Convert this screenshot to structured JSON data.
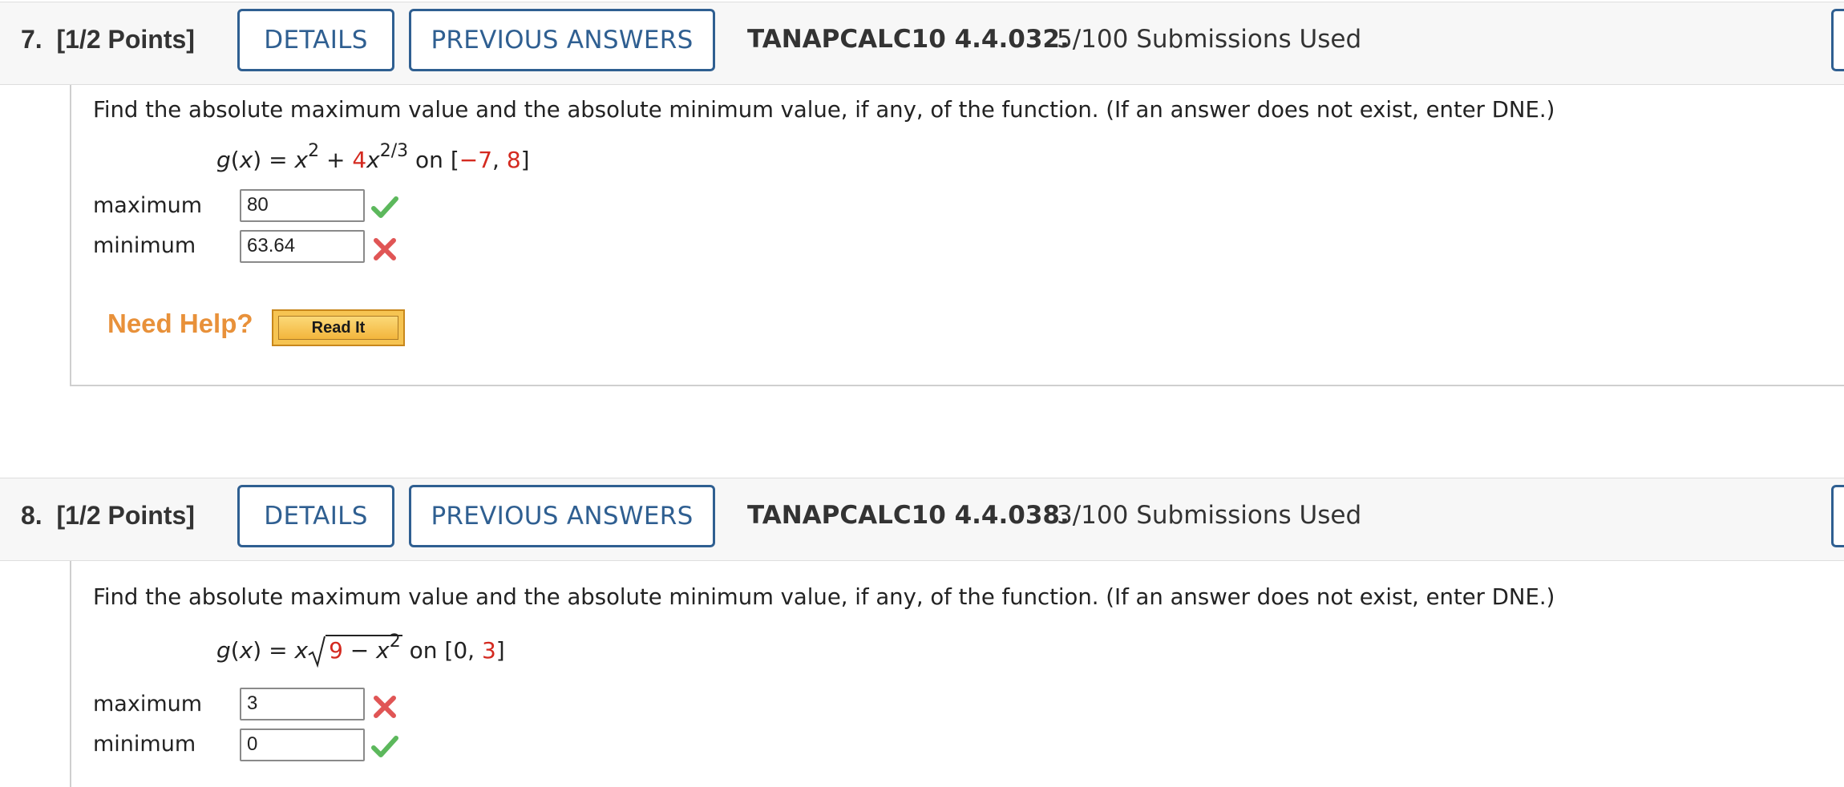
{
  "questions": [
    {
      "number": "7.",
      "points": "[1/2 Points]",
      "details_label": "DETAILS",
      "prev_answers_label": "PREVIOUS ANSWERS",
      "code": "TANAPCALC10 4.4.032.",
      "submissions": "5/100 Submissions Used",
      "prompt": "Find the absolute maximum value and the absolute minimum value, if any, of the function. (If an answer does not exist, enter DNE.)",
      "formula": {
        "lhs": "g(x) = ",
        "x": "x",
        "exp1": "2",
        "plus": " + ",
        "coef": "4",
        "x2": "x",
        "exp2": "2/3",
        "on": " on [",
        "a": "−7",
        "comma": ", ",
        "b": "8",
        "close": "]"
      },
      "maximum_label": "maximum",
      "maximum_value": "80",
      "maximum_status": "correct",
      "minimum_label": "minimum",
      "minimum_value": "63.64",
      "minimum_status": "incorrect",
      "need_help": "Need Help?",
      "read_it": "Read It"
    },
    {
      "number": "8.",
      "points": "[1/2 Points]",
      "details_label": "DETAILS",
      "prev_answers_label": "PREVIOUS ANSWERS",
      "code": "TANAPCALC10 4.4.038.",
      "submissions": "3/100 Submissions Used",
      "prompt": "Find the absolute maximum value and the absolute minimum value, if any, of the function. (If an answer does not exist, enter DNE.)",
      "formula": {
        "lhs": "g(x) = x",
        "rad_a": "9",
        "rad_minus": " − ",
        "rad_x": "x",
        "rad_exp": "2",
        "on": " on [0, ",
        "b": "3",
        "close": "]"
      },
      "maximum_label": "maximum",
      "maximum_value": "3",
      "maximum_status": "incorrect",
      "minimum_label": "minimum",
      "minimum_value": "0",
      "minimum_status": "correct"
    }
  ],
  "colors": {
    "button_blue": "#2f5f91",
    "highlight_red": "#d42a20",
    "check_green": "#5cb85c",
    "cross_red": "#e05555",
    "help_orange": "#e8913a"
  }
}
